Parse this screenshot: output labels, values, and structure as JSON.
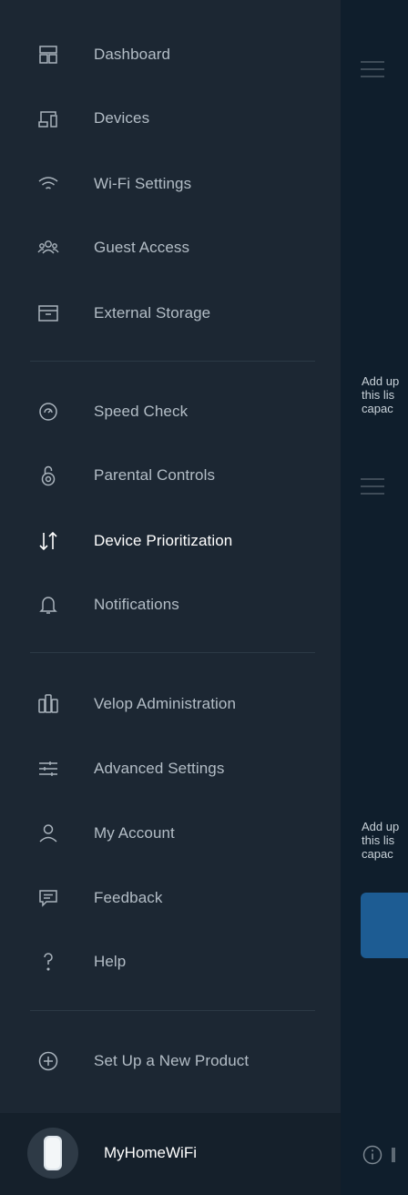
{
  "nav": {
    "group1": [
      {
        "id": "dashboard",
        "label": "Dashboard",
        "icon": "dashboard-icon"
      },
      {
        "id": "devices",
        "label": "Devices",
        "icon": "devices-icon"
      },
      {
        "id": "wifi-settings",
        "label": "Wi-Fi Settings",
        "icon": "wifi-icon"
      },
      {
        "id": "guest-access",
        "label": "Guest Access",
        "icon": "guest-icon"
      },
      {
        "id": "external-storage",
        "label": "External Storage",
        "icon": "storage-icon"
      }
    ],
    "group2": [
      {
        "id": "speed-check",
        "label": "Speed Check",
        "icon": "speedometer-icon"
      },
      {
        "id": "parental-controls",
        "label": "Parental Controls",
        "icon": "lock-icon"
      },
      {
        "id": "device-prioritization",
        "label": "Device Prioritization",
        "icon": "priority-arrows-icon",
        "active": true
      },
      {
        "id": "notifications",
        "label": "Notifications",
        "icon": "bell-icon"
      }
    ],
    "group3": [
      {
        "id": "velop-administration",
        "label": "Velop Administration",
        "icon": "velop-nodes-icon"
      },
      {
        "id": "advanced-settings",
        "label": "Advanced Settings",
        "icon": "sliders-icon"
      },
      {
        "id": "my-account",
        "label": "My Account",
        "icon": "person-icon"
      },
      {
        "id": "feedback",
        "label": "Feedback",
        "icon": "chat-icon"
      },
      {
        "id": "help",
        "label": "Help",
        "icon": "question-icon"
      }
    ],
    "group4": [
      {
        "id": "set-up-new-product",
        "label": "Set Up a New Product",
        "icon": "plus-circle-icon"
      }
    ]
  },
  "footer": {
    "network_name": "MyHomeWiFi",
    "icon": "velop-node-icon"
  },
  "content_peek": {
    "text_1": [
      "Add up",
      "this lis",
      "capac"
    ],
    "text_2": [
      "Add up",
      "this lis",
      "capac"
    ],
    "icon_hamburger": "hamburger-icon",
    "icon_info": "info-icon"
  },
  "colors": {
    "drawer_bg": "#1c2733",
    "content_bg": "#0f1e2c",
    "active_text": "#ffffff",
    "inactive_text": "#b3bdc6",
    "accent_button": "#1d5c93"
  }
}
